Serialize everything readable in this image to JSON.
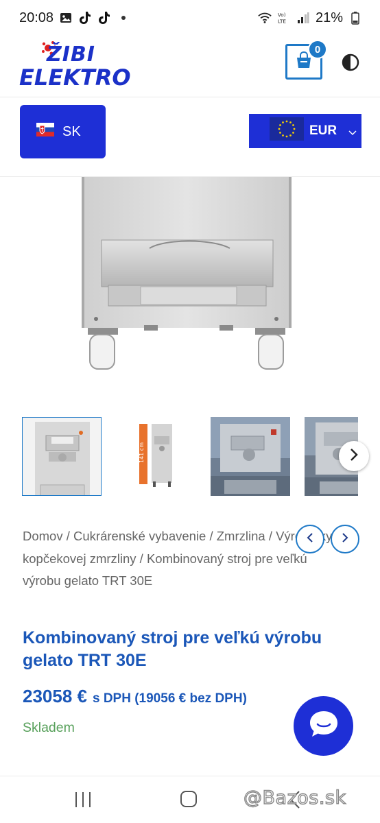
{
  "status_bar": {
    "time": "20:08",
    "battery": "21%",
    "icons": [
      "gallery-icon",
      "tiktok-icon",
      "tiktok-icon",
      "dot-icon",
      "wifi-icon",
      "volte-icon",
      "signal-icon",
      "battery-icon"
    ]
  },
  "header": {
    "logo_line1": "ŽIBI",
    "logo_line2": "ELEKTRO",
    "cart_count": "0",
    "icons": [
      "shopping-bag-icon",
      "contrast-toggle-icon"
    ]
  },
  "selectors": {
    "language": "SK",
    "currency": "EUR"
  },
  "breadcrumb": {
    "text": "Domov / Cukrárenské vybavenie / Zmrzlina / Výrobníky kopčekovej zmrzliny / Kombinovaný stroj pre veľkú výrobu gelato TRT 30E"
  },
  "product": {
    "title": "Kombinovaný stroj pre veľkú výrobu gelato TRT 30E",
    "price": "23058 €",
    "price_note": "s DPH (19056 € bez DPH)",
    "stock": "Skladem",
    "thumbnail_label": "141 cm"
  },
  "watermark": "@Bazos.sk",
  "colors": {
    "brand_blue": "#1e2fd6",
    "link_blue": "#1b57b8",
    "accent_blue": "#1e79c7",
    "stock_green": "#57a05a"
  }
}
